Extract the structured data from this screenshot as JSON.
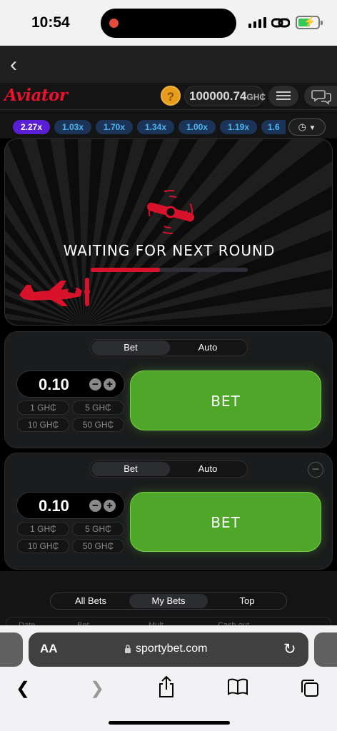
{
  "status_bar": {
    "time": "10:54"
  },
  "app_bar": {
    "back_icon": "chevron-left-icon"
  },
  "header": {
    "logo": "Aviator",
    "help_label": "?",
    "balance": "100000.74",
    "currency": "GH₵"
  },
  "multipliers": [
    "2.27x",
    "1.03x",
    "1.70x",
    "1.34x",
    "1.00x",
    "1.19x",
    "1.6"
  ],
  "game": {
    "status": "WAITING FOR NEXT ROUND",
    "progress": 0.44,
    "accent_color": "#d7122a"
  },
  "bet_panels": [
    {
      "tab_bet": "Bet",
      "tab_auto": "Auto",
      "amount": "0.10",
      "quick": [
        "1 GH₵",
        "5 GH₵",
        "10 GH₵",
        "50 GH₵"
      ],
      "bet_label": "BET"
    },
    {
      "tab_bet": "Bet",
      "tab_auto": "Auto",
      "amount": "0.10",
      "quick": [
        "1 GH₵",
        "5 GH₵",
        "10 GH₵",
        "50 GH₵"
      ],
      "bet_label": "BET"
    }
  ],
  "bets_tabs": {
    "all": "All Bets",
    "mine": "My Bets",
    "top": "Top"
  },
  "bets_table_headers": [
    "Date",
    "Bet",
    "Mult.",
    "Cash out"
  ],
  "browser": {
    "aa": "AA",
    "url": "sportybet.com"
  },
  "colors": {
    "bet_green": "#4fa72a",
    "brand_red": "#e5132c",
    "chip_blue": "#4bb6f2",
    "chip_purple": "#5a1fd4"
  }
}
